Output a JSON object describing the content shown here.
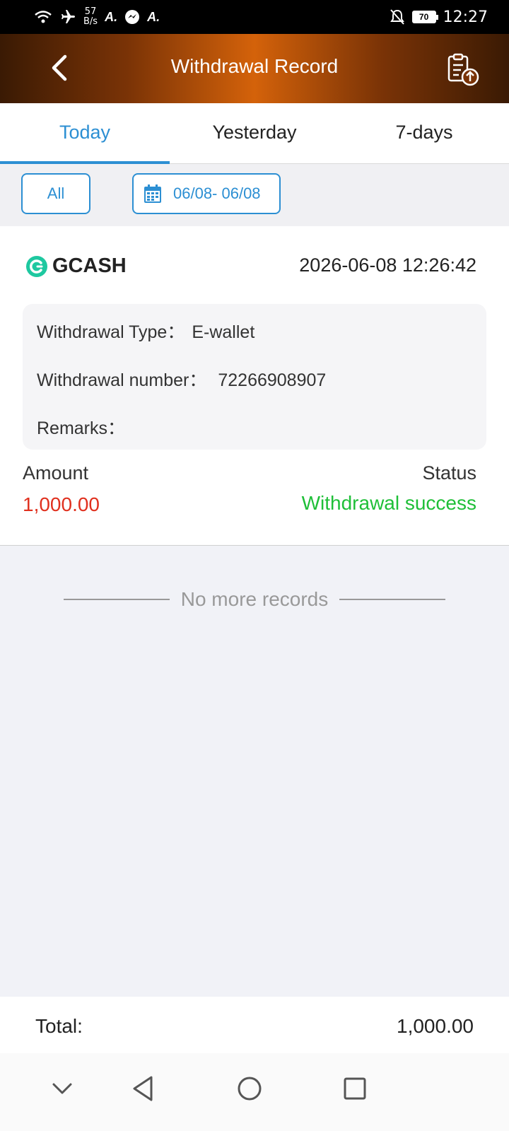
{
  "status_bar": {
    "speed_value": "57",
    "speed_unit": "B/s",
    "app_icons": [
      "A",
      "messenger",
      "A"
    ],
    "battery": "70",
    "time": "12:27"
  },
  "header": {
    "title": "Withdrawal Record",
    "back_icon": "chevron-left-icon",
    "export_icon": "clipboard-upload-icon"
  },
  "tabs": [
    {
      "label": "Today",
      "active": true
    },
    {
      "label": "Yesterday",
      "active": false
    },
    {
      "label": "7-days",
      "active": false
    }
  ],
  "filters": {
    "all_label": "All",
    "date_range": "06/08- 06/08"
  },
  "record": {
    "method": "GCASH",
    "datetime": "2026-06-08 12:26:42",
    "type_label": "Withdrawal Type：",
    "type_value": "E-wallet",
    "number_label": "Withdrawal number：",
    "number_value": "72266908907",
    "remarks_label": "Remarks：",
    "remarks_value": "",
    "amount_label": "Amount",
    "amount_value": "1,000.00",
    "status_label": "Status",
    "status_value": "Withdrawal success"
  },
  "list_end_text": "No more records",
  "footer": {
    "total_label": "Total:",
    "total_value": "1,000.00"
  },
  "colors": {
    "accent": "#2c8fd3",
    "amount": "#e0301e",
    "success": "#1fbf38",
    "header_center": "#d4620a",
    "header_edge": "#3a1a04"
  }
}
